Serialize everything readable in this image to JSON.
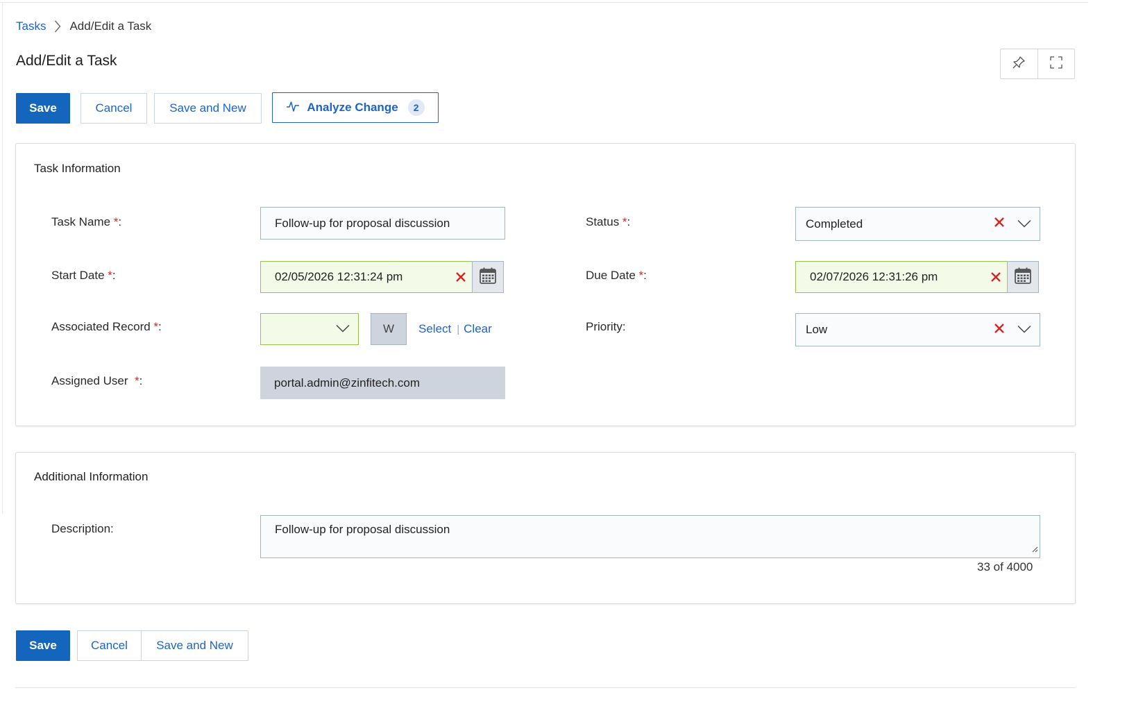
{
  "breadcrumb": {
    "root": "Tasks",
    "current": "Add/Edit a Task"
  },
  "page": {
    "title": "Add/Edit a Task"
  },
  "toolbar_top": {
    "save": "Save",
    "cancel": "Cancel",
    "save_new": "Save and New",
    "analyze": "Analyze Change",
    "analyze_count": "2"
  },
  "task_info": {
    "title": "Task Information",
    "task_name_label": "Task Name ",
    "task_name_value": "Follow-up for proposal discussion",
    "status_label": "Status ",
    "status_value": "Completed",
    "start_date_label": "Start Date ",
    "start_date_value": "02/05/2026 12:31:24 pm",
    "due_date_label": "Due Date ",
    "due_date_value": "02/07/2026 12:31:26 pm",
    "assoc_label": "Associated Record ",
    "assoc_mini": "W",
    "assoc_select": "Select",
    "assoc_clear": "Clear",
    "priority_label": "Priority:",
    "priority_value": "Low",
    "assigned_label": "Assigned User  ",
    "assigned_value": "portal.admin@zinfitech.com",
    "required_mark": "*",
    "colon": ":"
  },
  "additional_info": {
    "title": "Additional Information",
    "description_label": "Description:",
    "description_value": "Follow-up for proposal discussion",
    "char_count": "33 of 4000"
  },
  "toolbar_bottom": {
    "save": "Save",
    "cancel": "Cancel",
    "save_new": "Save and New"
  },
  "colors": {
    "primary": "#1466bd",
    "link": "#1f63c4",
    "required": "#d42525",
    "valid_border": "#94c24b",
    "valid_bg": "#f3fae8"
  }
}
